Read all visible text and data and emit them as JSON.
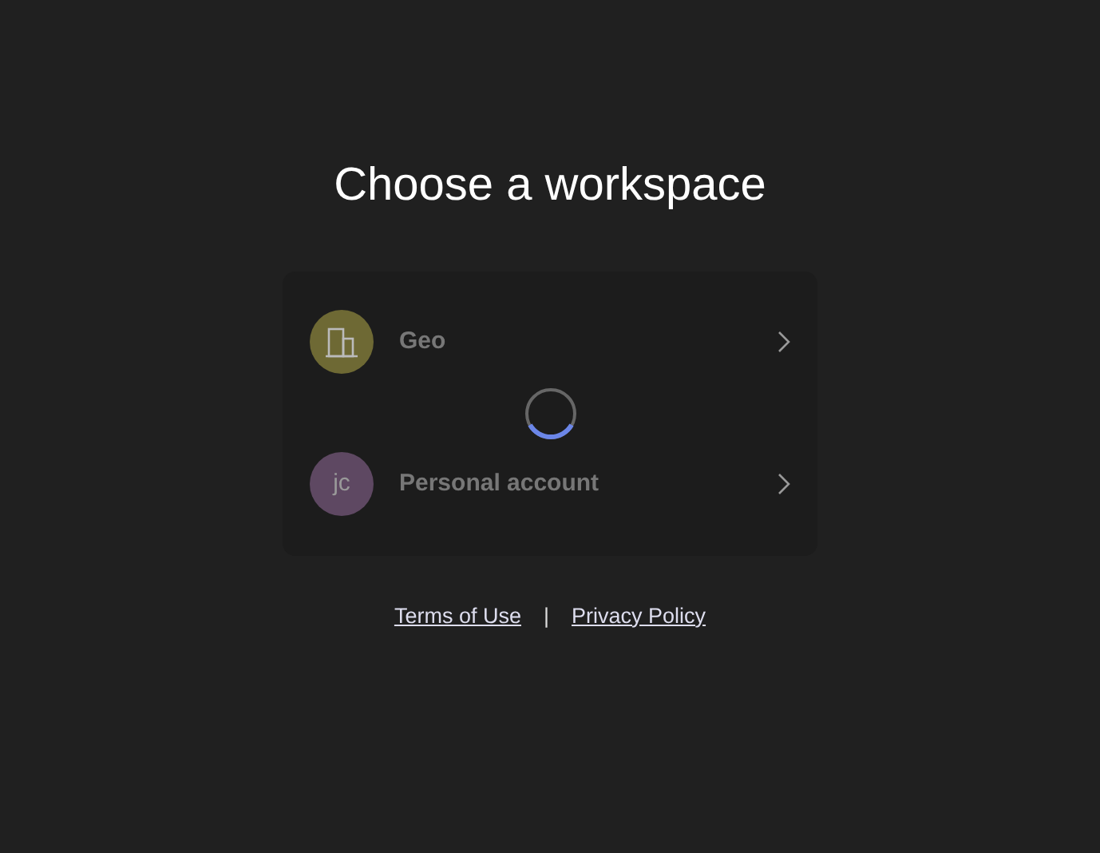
{
  "title": "Choose a workspace",
  "workspaces": {
    "loading": true,
    "items": [
      {
        "kind": "icon",
        "name": "Geo",
        "color": "#6e6934"
      },
      {
        "kind": "initials",
        "initials": "jc",
        "name": "Personal account",
        "color": "#5e4862"
      }
    ]
  },
  "footer": {
    "links": [
      "Terms of Use",
      "Privacy Policy"
    ],
    "separator": "|"
  }
}
